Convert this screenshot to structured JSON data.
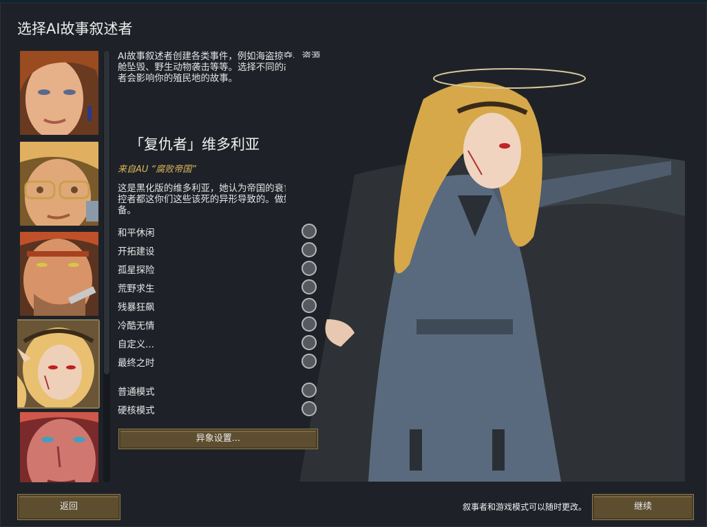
{
  "window": {
    "title": "选择AI故事叙述者"
  },
  "intro_text": "AI故事叙述者创建各类事件，例如海盗掠夺、资源舱坠毁、野生动物袭击等等。选择不同的故事叙述者会影响你的殖民地的故事。",
  "storytellers": [
    {
      "portrait": "storyteller-portrait-1",
      "selected": false
    },
    {
      "portrait": "storyteller-portrait-2",
      "selected": false
    },
    {
      "portrait": "storyteller-portrait-3",
      "selected": false
    },
    {
      "portrait": "storyteller-portrait-4",
      "selected": true
    },
    {
      "portrait": "storyteller-portrait-5",
      "selected": false
    }
  ],
  "selected_storyteller": {
    "name": "「复仇者」维多利亚",
    "source": "来自AU “腐败帝国”",
    "description": "这是黑化版的维多利亚，她认为帝国的衰亡和掌控者都这你们这些该死的异形导致的。做好准备。"
  },
  "difficulties": [
    {
      "label": "和平休闲"
    },
    {
      "label": "开拓建设"
    },
    {
      "label": "孤星探险"
    },
    {
      "label": "荒野求生"
    },
    {
      "label": "残暴狂飙"
    },
    {
      "label": "冷酷无情"
    },
    {
      "label": "自定义..."
    },
    {
      "label": "最终之时"
    }
  ],
  "modes": [
    {
      "label": "普通模式"
    },
    {
      "label": "硬核模式"
    }
  ],
  "buttons": {
    "anomaly": "异象设置...",
    "back": "返回",
    "continue": "继续"
  },
  "footer_note": "叙事者和游戏模式可以随时更改。",
  "colors": {
    "button_bg": "#5e4e30",
    "button_border": "#8e7b50",
    "source_text": "#e0b65a",
    "dialog_bg": "#1e2228"
  }
}
